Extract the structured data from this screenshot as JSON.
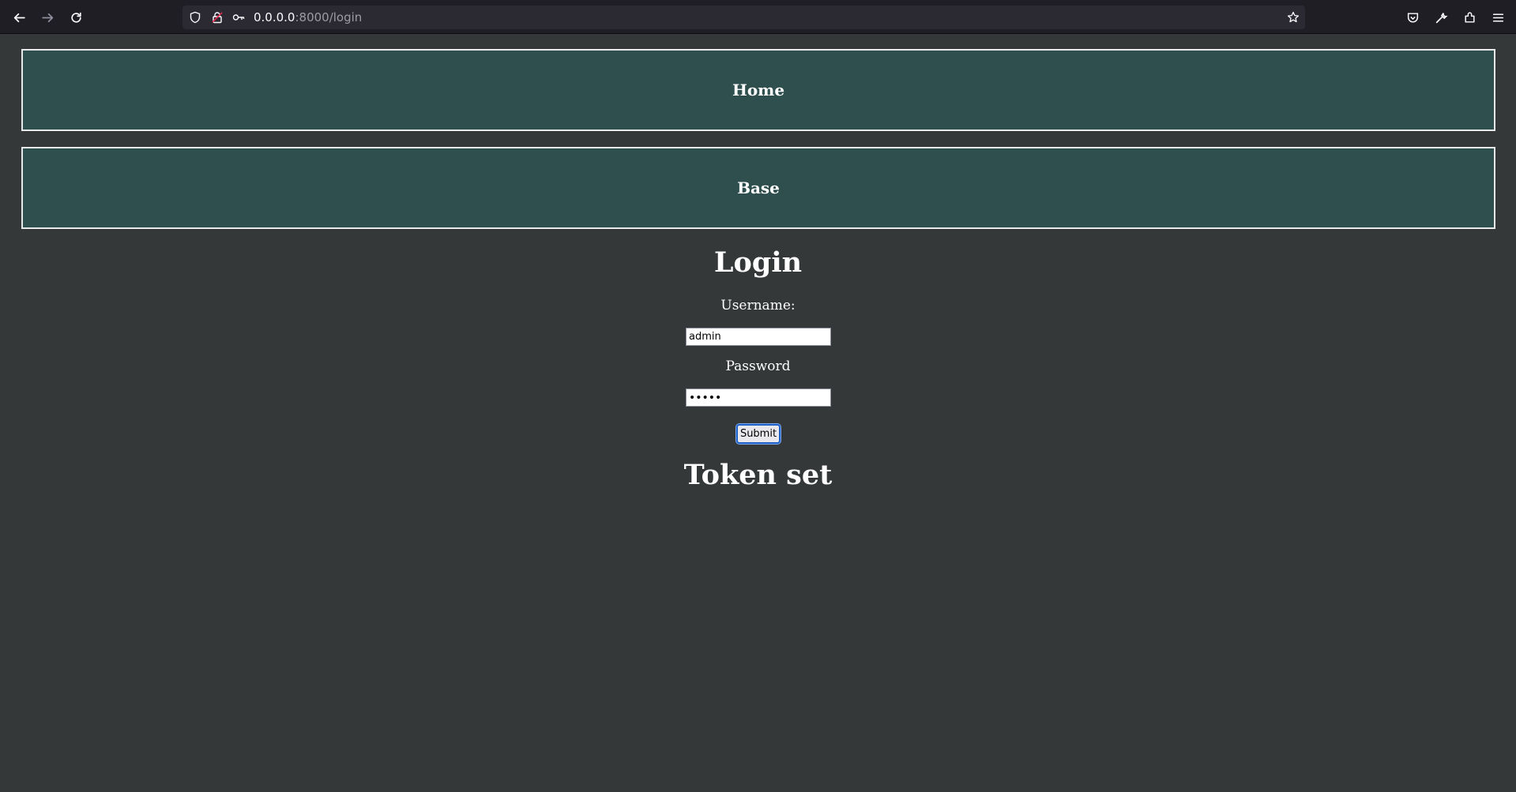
{
  "browser": {
    "url_host": "0.0.0.0",
    "url_rest": ":8000/login"
  },
  "nav": {
    "home_label": "Home",
    "base_label": "Base"
  },
  "form": {
    "title": "Login",
    "username_label": "Username:",
    "username_value": "admin",
    "password_label": "Password",
    "password_value": "admin",
    "submit_label": "Submit"
  },
  "status": {
    "message": "Token set"
  },
  "colors": {
    "page_bg": "#343839",
    "nav_bg": "#2f4f4f",
    "toolbar_bg": "#1f1e25"
  }
}
